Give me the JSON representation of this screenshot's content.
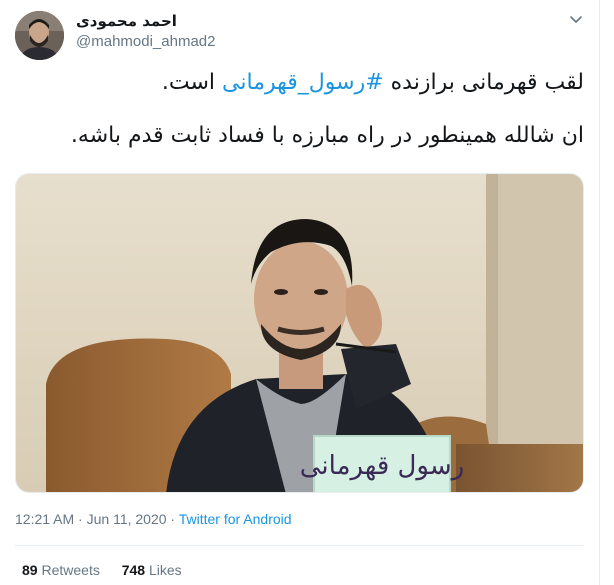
{
  "author": {
    "display_name": "احمد محمودی",
    "handle": "@mahmodi_ahmad2"
  },
  "tweet": {
    "line1_prefix": "لقب قهرمانی برازنده ",
    "line1_hashtag": "#رسول_قهرمانی",
    "line1_suffix": " است.",
    "line2": "ان شالله همینطور در راه مبارزه با فساد ثابت قدم باشه."
  },
  "media": {
    "nameplate_text": "رسول قهرمانی"
  },
  "meta": {
    "time": "12:21 AM",
    "separator1": " · ",
    "date": "Jun 11, 2020",
    "separator2": " · ",
    "source": "Twitter for Android"
  },
  "stats": {
    "retweets_count": "89",
    "retweets_label": "Retweets",
    "likes_count": "748",
    "likes_label": "Likes"
  },
  "colors": {
    "link": "#1b95e0",
    "secondary_text": "#657786",
    "primary_text": "#14171a",
    "border": "#e6ecf0"
  },
  "icons": {
    "menu": "chevron-down-icon"
  }
}
